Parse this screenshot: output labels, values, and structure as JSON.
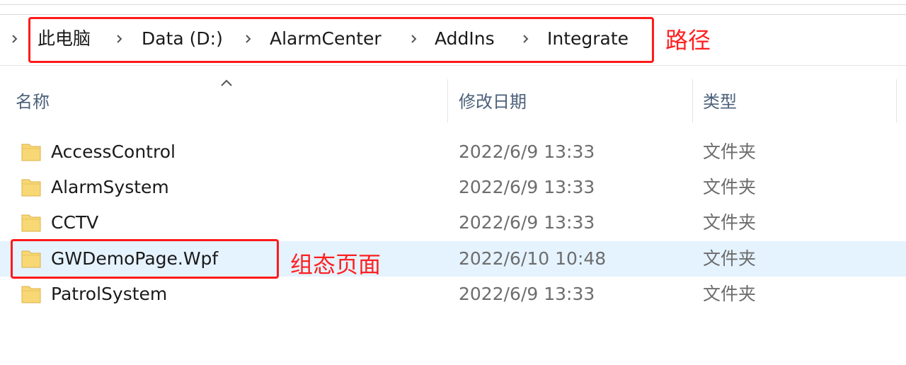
{
  "address_bar": {
    "breadcrumbs": [
      "此电脑",
      "Data (D:)",
      "AlarmCenter",
      "AddIns",
      "Integrate"
    ]
  },
  "annotations": {
    "path_label": "路径",
    "config_page_label": "组态页面"
  },
  "columns": {
    "name": "名称",
    "date_modified": "修改日期",
    "type": "类型"
  },
  "files": [
    {
      "name": "AccessControl",
      "date": "2022/6/9 13:33",
      "type": "文件夹",
      "icon": "folder-icon"
    },
    {
      "name": "AlarmSystem",
      "date": "2022/6/9 13:33",
      "type": "文件夹",
      "icon": "folder-icon"
    },
    {
      "name": "CCTV",
      "date": "2022/6/9 13:33",
      "type": "文件夹",
      "icon": "folder-icon"
    },
    {
      "name": "GWDemoPage.Wpf",
      "date": "2022/6/10 10:48",
      "type": "文件夹",
      "icon": "folder-icon",
      "selected": true
    },
    {
      "name": "PatrolSystem",
      "date": "2022/6/9 13:33",
      "type": "文件夹",
      "icon": "folder-icon"
    }
  ],
  "colors": {
    "highlight_box": "#ff1a1a",
    "selection": "#e5f3ff",
    "folder": "#f8d775"
  }
}
